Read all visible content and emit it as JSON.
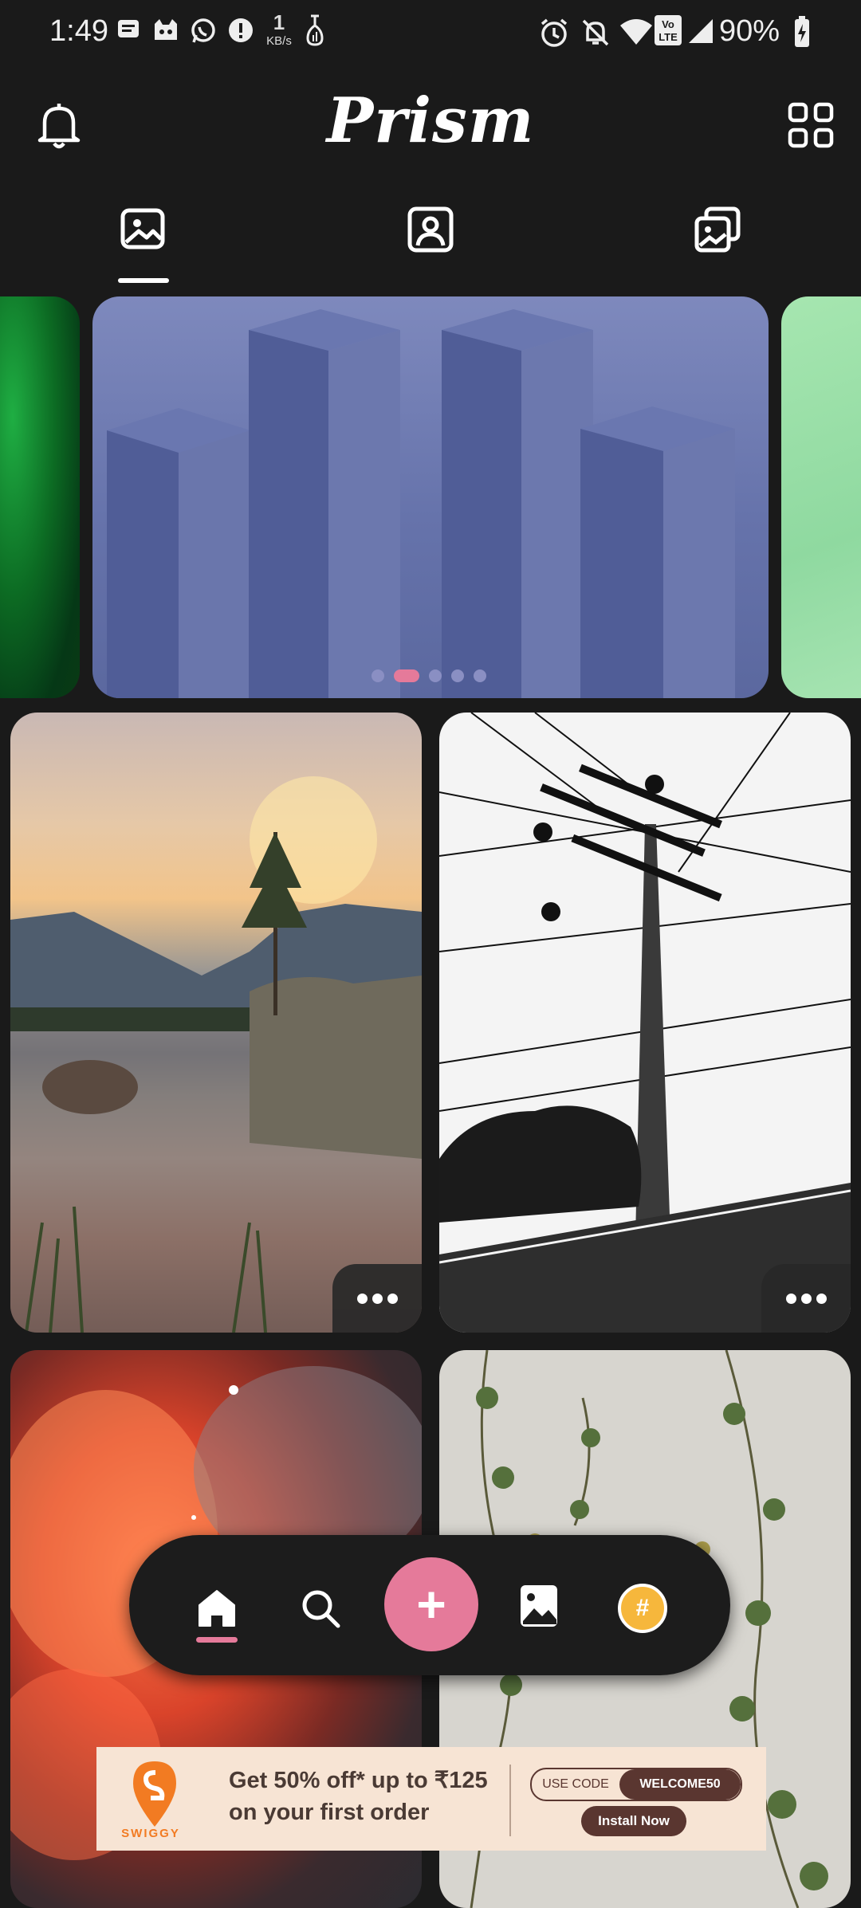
{
  "status_bar": {
    "time": "1:49",
    "network_speed_value": "1",
    "network_speed_unit": "KB/s",
    "battery_percent": "90%",
    "icons": [
      "message-icon",
      "cat-icon",
      "whatsapp-icon",
      "alert-icon",
      "data-icon",
      "alarm-icon",
      "mute-icon",
      "wifi-icon",
      "volte-icon",
      "signal-icon",
      "battery-charging-icon"
    ]
  },
  "header": {
    "title": "Prism",
    "left_icon": "bell-icon",
    "right_icon": "grid-icon"
  },
  "tabs": [
    {
      "icon": "wallpaper-icon",
      "active": true
    },
    {
      "icon": "profile-icon",
      "active": false
    },
    {
      "icon": "collections-icon",
      "active": false
    }
  ],
  "carousel": {
    "dots": 5,
    "active_dot": 2
  },
  "bottom_nav": {
    "items": [
      "home-icon",
      "search-icon",
      "add-icon",
      "wallpaper-icon",
      "trending-icon"
    ],
    "add_symbol": "+",
    "trending_symbol": "#",
    "accent": "#e57a9a"
  },
  "ad": {
    "brand": "SWIGGY",
    "headline_line1": "Get 50% off* up to ₹125",
    "headline_line2": "on your first order",
    "code_label": "USE CODE",
    "code_value": "WELCOME50",
    "cta": "Install Now"
  }
}
